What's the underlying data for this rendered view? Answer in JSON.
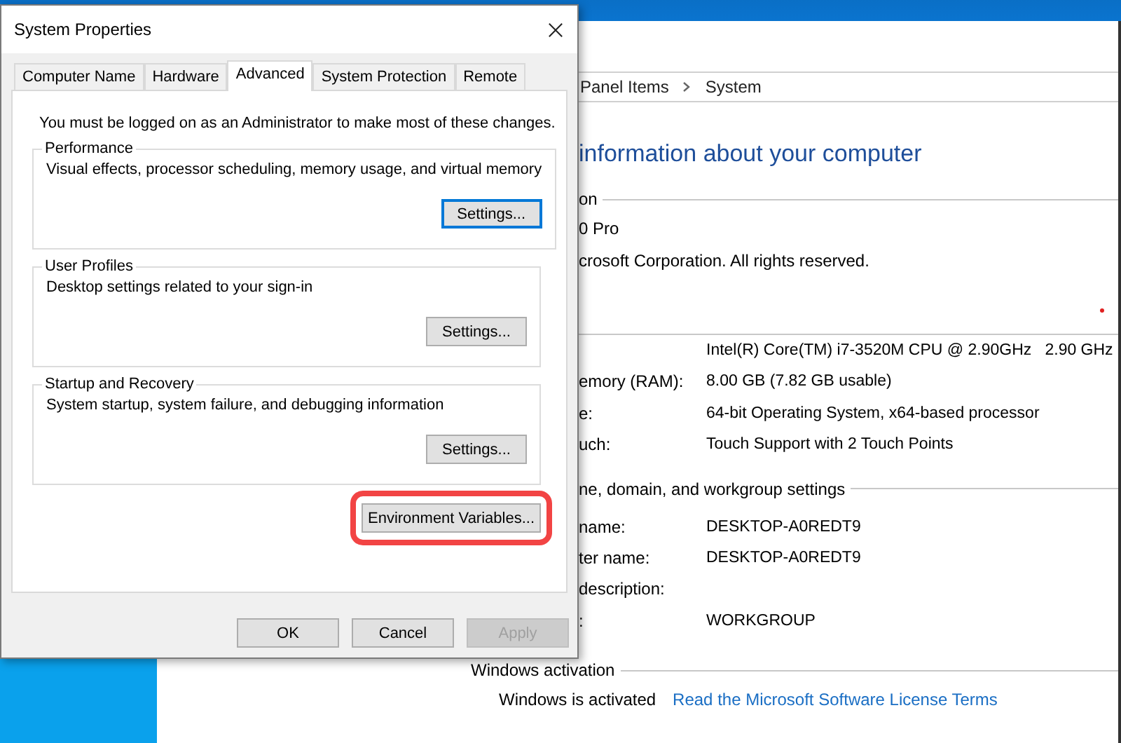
{
  "dialog": {
    "title": "System Properties",
    "tabs": [
      {
        "label": "Computer Name",
        "selected": false
      },
      {
        "label": "Hardware",
        "selected": false
      },
      {
        "label": "Advanced",
        "selected": true
      },
      {
        "label": "System Protection",
        "selected": false
      },
      {
        "label": "Remote",
        "selected": false
      }
    ],
    "notice": "You must be logged on as an Administrator to make most of these changes.",
    "groups": [
      {
        "title": "Performance",
        "description": "Visual effects, processor scheduling, memory usage, and virtual memory",
        "button": {
          "label": "Settings...",
          "focused": true
        }
      },
      {
        "title": "User Profiles",
        "description": "Desktop settings related to your sign-in",
        "button": {
          "label": "Settings...",
          "focused": false
        }
      },
      {
        "title": "Startup and Recovery",
        "description": "System startup, system failure, and debugging information",
        "button": {
          "label": "Settings...",
          "focused": false
        }
      }
    ],
    "environment_button": {
      "label": "Environment Variables...",
      "highlighted": true
    },
    "buttons": [
      {
        "label": "OK",
        "disabled": false
      },
      {
        "label": "Cancel",
        "disabled": false
      },
      {
        "label": "Apply",
        "disabled": true
      }
    ]
  },
  "background_window": {
    "breadcrumb": [
      "Panel Items",
      "System"
    ],
    "heading": "information about your computer",
    "edition_section": {
      "title": "on",
      "lines": [
        "0 Pro",
        "crosoft Corporation. All rights reserved."
      ]
    },
    "system_rows": [
      {
        "value": "Intel(R) Core(TM) i7-3520M CPU @ 2.90GHz   2.90 GHz"
      },
      {
        "label": "emory (RAM):",
        "value": "8.00 GB (7.82 GB usable)"
      },
      {
        "label": "e:",
        "value": "64-bit Operating System, x64-based processor"
      },
      {
        "label": "uch:",
        "value": "Touch Support with 2 Touch Points"
      }
    ],
    "computer_section": {
      "title": "ne, domain, and workgroup settings",
      "rows": [
        {
          "label": "name:",
          "value": "DESKTOP-A0REDT9"
        },
        {
          "label": "ter name:",
          "value": "DESKTOP-A0REDT9"
        },
        {
          "label": "description:"
        },
        {
          "label": ":",
          "value": "WORKGROUP"
        }
      ]
    },
    "activation_section": {
      "title": "Windows activation",
      "status": "Windows is activated",
      "link": "Read the Microsoft Software License Terms"
    }
  }
}
